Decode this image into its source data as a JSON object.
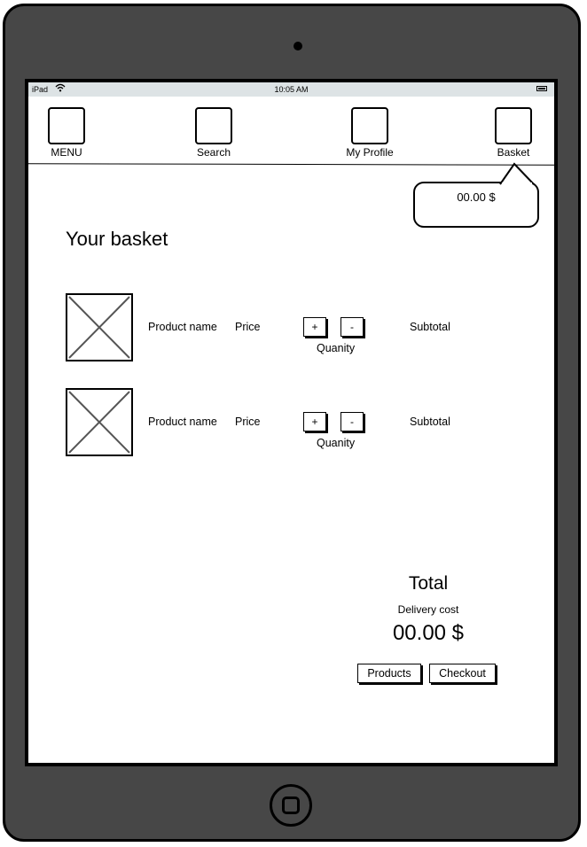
{
  "status_bar": {
    "carrier": "iPad",
    "time": "10:05 AM"
  },
  "nav": {
    "menu": "MENU",
    "search": "Search",
    "profile": "My Profile",
    "basket": "Basket"
  },
  "basket_bubble": {
    "amount": "00.00 $"
  },
  "page": {
    "title": "Your basket"
  },
  "items": [
    {
      "name": "Product name",
      "price": "Price",
      "plus": "+",
      "minus": "-",
      "quantity_label": "Quanity",
      "subtotal": "Subtotal"
    },
    {
      "name": "Product name",
      "price": "Price",
      "plus": "+",
      "minus": "-",
      "quantity_label": "Quanity",
      "subtotal": "Subtotal"
    }
  ],
  "summary": {
    "total_label": "Total",
    "delivery_label": "Delivery cost",
    "amount": "00.00 $"
  },
  "actions": {
    "products": "Products",
    "checkout": "Checkout"
  }
}
